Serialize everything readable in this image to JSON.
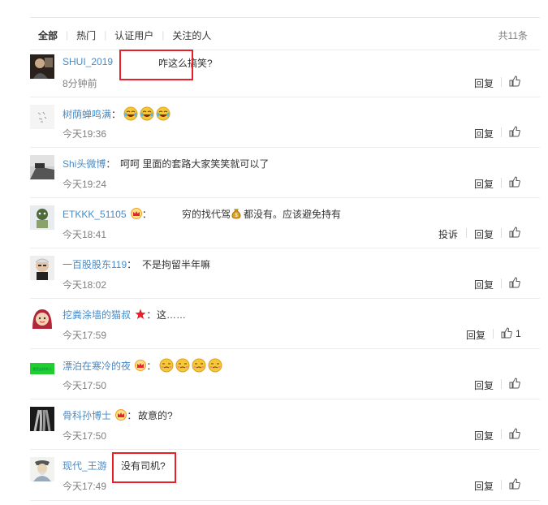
{
  "tabs": [
    "全部",
    "热门",
    "认证用户",
    "关注的人"
  ],
  "total": "共11条",
  "reply_label": "回复",
  "report_label": "投诉",
  "comments": [
    {
      "user": "SHUI_2019",
      "text": "咋这么搞笑?",
      "time": "8分钟前"
    },
    {
      "user": "树荫蝉鸣满",
      "text": "",
      "time": "今天19:36"
    },
    {
      "user": "Shi头微博",
      "text": "呵呵 里面的套路大家笑笑就可以了",
      "time": "今天19:24"
    },
    {
      "user": "ETKKK_51105",
      "text_a": "穷的找代驾",
      "text_b": "都没有。应该避免持有",
      "time": "今天18:41"
    },
    {
      "user": "一百股股东119",
      "text": "不是拘留半年嘛",
      "time": "今天18:02"
    },
    {
      "user": "挖粪涂墙的猫叔",
      "text": "这……",
      "time": "今天17:59",
      "likes": "1"
    },
    {
      "user": "漂泊在寒冷的夜",
      "text": "",
      "time": "今天17:50"
    },
    {
      "user": "骨科孙博士",
      "text": "故意的?",
      "time": "今天17:50"
    },
    {
      "user": "现代_王游",
      "text": "没有司机?",
      "time": "今天17:49"
    }
  ],
  "avatar_text": "我是这样的人"
}
